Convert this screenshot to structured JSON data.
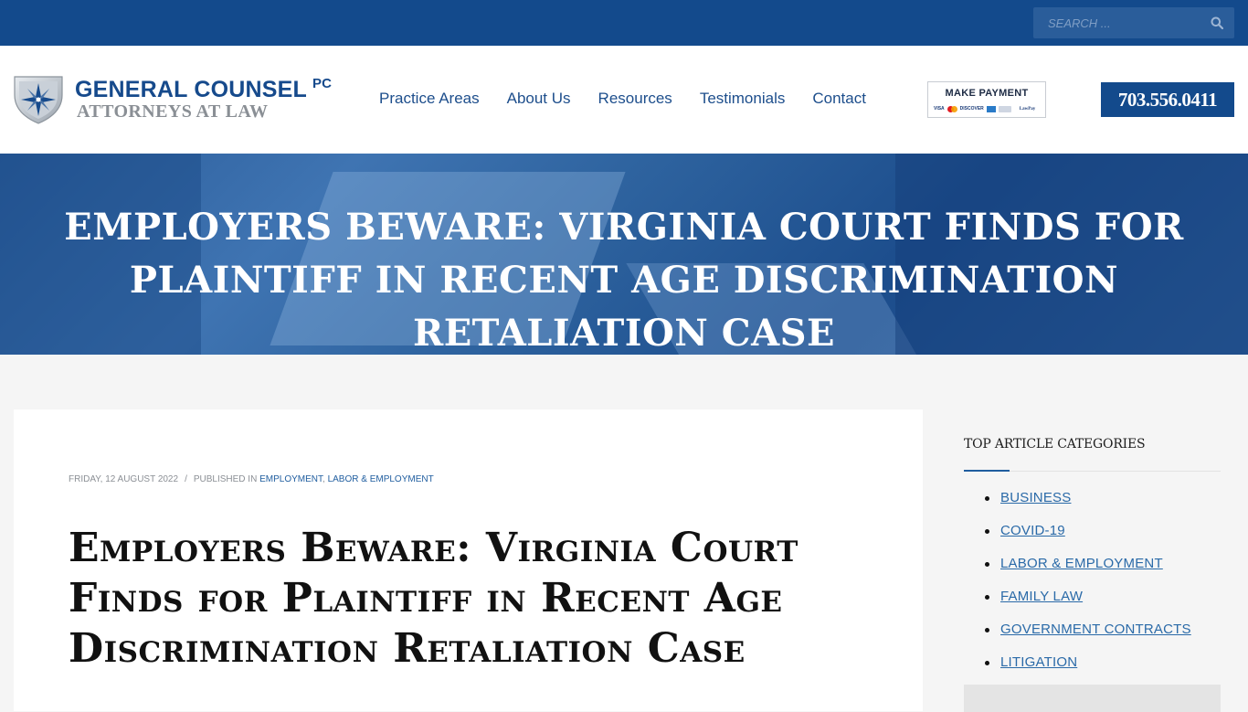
{
  "search": {
    "placeholder": "SEARCH ..."
  },
  "logo": {
    "title": "GENERAL COUNSEL",
    "suffix": "PC",
    "subtitle": "ATTORNEYS AT LAW"
  },
  "nav": {
    "items": [
      {
        "label": "Practice Areas"
      },
      {
        "label": "About Us"
      },
      {
        "label": "Resources"
      },
      {
        "label": "Testimonials"
      },
      {
        "label": "Contact"
      }
    ]
  },
  "payment": {
    "label": "MAKE PAYMENT",
    "cards": [
      "VISA",
      "DISCOVER",
      "LawPay"
    ]
  },
  "phone": "703.556.0411",
  "hero": {
    "title": "EMPLOYERS BEWARE: VIRGINIA COURT FINDS FOR PLAINTIFF IN RECENT AGE DISCRIMINATION RETALIATION CASE"
  },
  "article": {
    "date": "FRIDAY, 12 AUGUST 2022",
    "separator": "/",
    "published_in": "PUBLISHED IN",
    "categories": [
      "EMPLOYMENT",
      "LABOR & EMPLOYMENT"
    ],
    "category_separator": ",",
    "title": "Employers Beware: Virginia Court Finds for Plaintiff in Recent Age Discrimination Retaliation Case"
  },
  "sidebar": {
    "title": "TOP ARTICLE CATEGORIES",
    "categories": [
      {
        "label": "BUSINESS"
      },
      {
        "label": "COVID-19"
      },
      {
        "label": "LABOR & EMPLOYMENT"
      },
      {
        "label": "FAMILY LAW"
      },
      {
        "label": "GOVERNMENT CONTRACTS"
      },
      {
        "label": "LITIGATION"
      }
    ]
  },
  "colors": {
    "brand": "#134a8c",
    "link": "#2a6aa8",
    "logo_gray": "#8a8f95"
  }
}
